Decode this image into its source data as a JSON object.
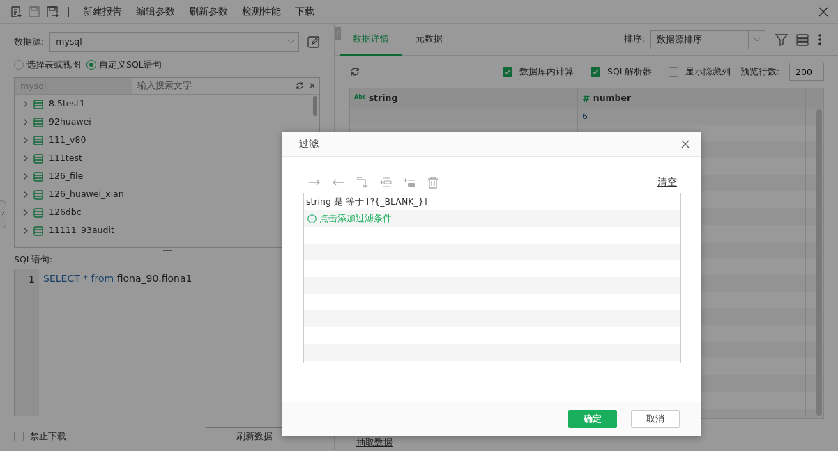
{
  "toolbar": {
    "menu": [
      "新建报告",
      "编辑参数",
      "刷新参数",
      "检测性能",
      "下载"
    ]
  },
  "datasource": {
    "label": "数据源:",
    "value": "mysql"
  },
  "source_mode": [
    {
      "label": "选择表或视图",
      "selected": false
    },
    {
      "label": "自定义SQL语句",
      "selected": true
    }
  ],
  "tree": {
    "source": "mysql",
    "search_placeholder": "输入搜索文字",
    "items": [
      "8.5test1",
      "92huawei",
      "111_v80",
      "111test",
      "126_file",
      "126_huawei_xian",
      "126dbc",
      "11111_93audit"
    ]
  },
  "sql": {
    "label": "SQL语句:",
    "lines": [
      {
        "number": "1",
        "tokens": [
          {
            "text": "SELECT * from",
            "kind": "keyword"
          },
          {
            "text": "fiona_90.fiona1",
            "kind": "identifier"
          }
        ]
      }
    ]
  },
  "disable_download": {
    "label": "禁止下载",
    "checked": false
  },
  "refresh_button": "刷新数据",
  "tabs": [
    {
      "label": "数据详情",
      "selected": true
    },
    {
      "label": "元数据",
      "selected": false
    }
  ],
  "sort": {
    "label": "排序:",
    "value": "数据源排序"
  },
  "options": [
    {
      "label": "数据库内计算",
      "checked": true
    },
    {
      "label": "SQL解析器",
      "checked": true
    },
    {
      "label": "显示隐藏列",
      "checked": false
    }
  ],
  "preview": {
    "label": "预览行数:",
    "value": "200"
  },
  "table": {
    "columns": [
      {
        "name": "string",
        "type_label": "Abc"
      },
      {
        "name": "number",
        "type_label": "#"
      }
    ],
    "rows": [
      {
        "number": "6"
      }
    ]
  },
  "extract_link": "抽取数据",
  "dialog": {
    "title": "过滤",
    "clear": "清空",
    "conditions": [
      "string 是 等于 [?{_BLANK_}]"
    ],
    "add_condition": "点击添加过滤条件",
    "ok": "确定",
    "cancel": "取消"
  }
}
